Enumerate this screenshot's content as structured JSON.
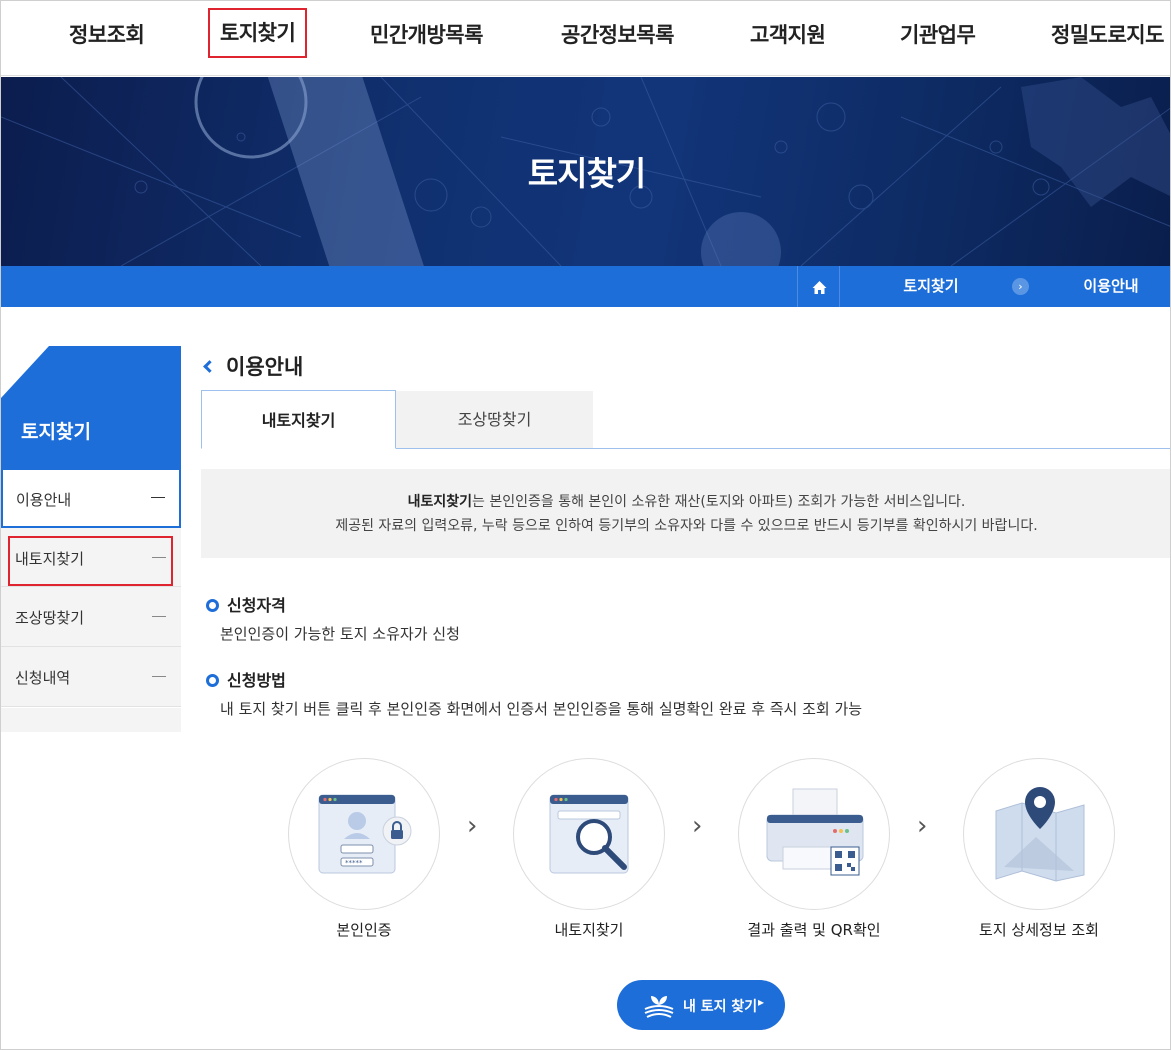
{
  "topnav": {
    "items": [
      "정보조회",
      "토지찾기",
      "민간개방목록",
      "공간정보목록",
      "고객지원",
      "기관업무",
      "정밀도로지도"
    ]
  },
  "hero": {
    "title": "토지찾기"
  },
  "breadcrumb": {
    "items": [
      "토지찾기",
      "이용안내"
    ]
  },
  "sidebar": {
    "title": "토지찾기",
    "items": [
      "이용안내",
      "내토지찾기",
      "조상땅찾기",
      "신청내역"
    ]
  },
  "main": {
    "section_title": "이용안내",
    "tabs": [
      "내토지찾기",
      "조상땅찾기"
    ],
    "notice": {
      "bold": "내토지찾기",
      "line1_rest": "는 본인인증을 통해 본인이 소유한 재산(토지와 아파트) 조회가 가능한 서비스입니다.",
      "line2": "제공된 자료의 입력오류, 누락 등으로 인하여 등기부의 소유자와 다를 수 있으므로 반드시 등기부를 확인하시기 바랍니다."
    },
    "qualification": {
      "title": "신청자격",
      "body": "본인인증이 가능한 토지 소유자가 신청"
    },
    "method": {
      "title": "신청방법",
      "body": "내 토지 찾기 버튼 클릭 후 본인인증 화면에서 인증서 본인인증을 통해 실명확인 완료 후 즉시 조회 가능"
    },
    "steps": [
      {
        "label": "본인인증",
        "icon": "id-verification-icon"
      },
      {
        "label": "내토지찾기",
        "icon": "magnifier-window-icon"
      },
      {
        "label": "결과 출력 및 QR확인",
        "icon": "printer-qr-icon"
      },
      {
        "label": "토지 상세정보 조회",
        "icon": "map-pin-icon"
      }
    ],
    "step_arrow": "›",
    "cta": {
      "label": "내 토지 찾기",
      "arrow": "▸"
    }
  },
  "colors": {
    "primary": "#1d6ed8",
    "highlight_red": "#e0242f",
    "hero_dark": "#0c1d4e"
  }
}
